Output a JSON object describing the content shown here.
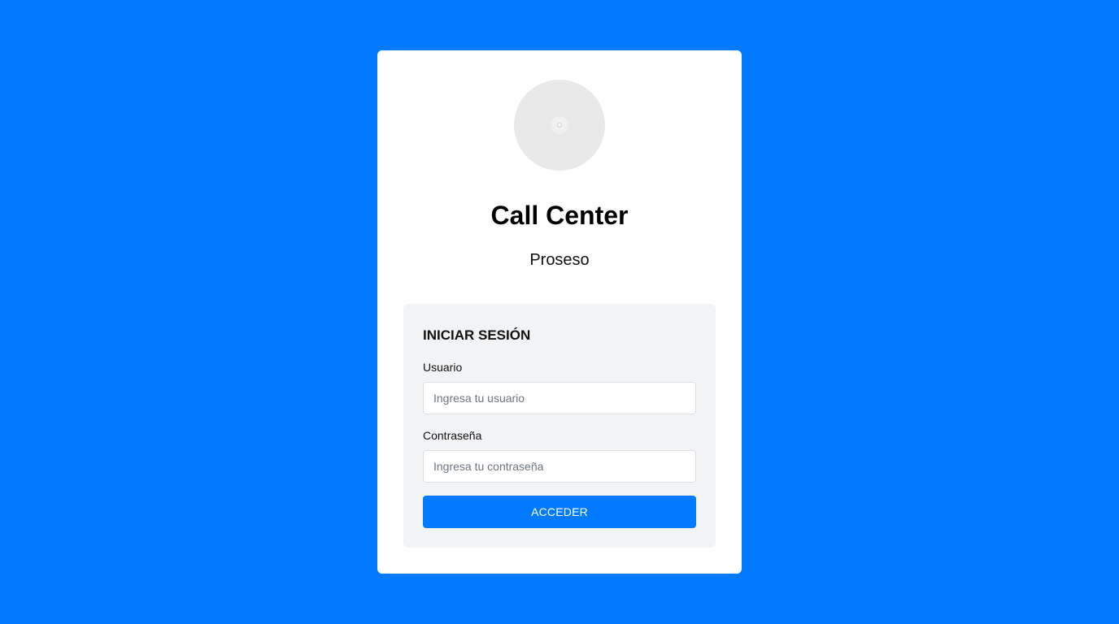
{
  "colors": {
    "background": "#007bff",
    "card": "#ffffff",
    "panel": "#f2f3f5",
    "button": "#007bff"
  },
  "header": {
    "avatar_icon": "placeholder-avatar-icon",
    "title": "Call Center",
    "subtitle": "Proseso"
  },
  "login": {
    "heading": "INICIAR SESIÓN",
    "username": {
      "label": "Usuario",
      "placeholder": "Ingresa tu usuario",
      "value": ""
    },
    "password": {
      "label": "Contraseña",
      "placeholder": "Ingresa tu contraseña",
      "value": ""
    },
    "submit_label": "ACCEDER"
  }
}
